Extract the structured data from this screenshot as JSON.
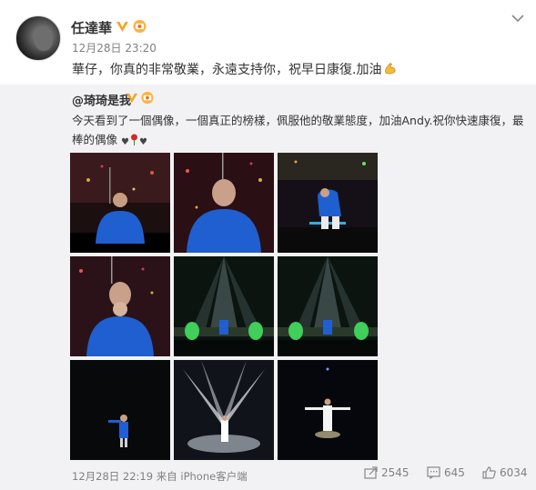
{
  "author": {
    "name": "任達華",
    "time": "12月28日 23:20",
    "verified_icon": "verified-v-icon",
    "vip_icon": "vip-badge-icon"
  },
  "post": {
    "text": "華仔，你真的非常敬業，永遠支持你，祝早日康復.加油",
    "emoji": "flexed-biceps-icon"
  },
  "repost": {
    "original_user": "@琦琦是我",
    "text": "今天看到了一個偶像，一個真正的榜樣，佩服他的敬業態度，加油Andy.祝你快速康復，最棒的偶像",
    "emoji_icons": [
      "heart-icon",
      "rose-icon",
      "heart-icon"
    ],
    "photos": [
      "photo-1",
      "photo-2",
      "photo-3",
      "photo-4",
      "photo-5",
      "photo-6",
      "photo-7",
      "photo-8",
      "photo-9"
    ],
    "footer": {
      "time": "12月28日 22:19",
      "source": "来自 iPhone客户端"
    },
    "actions": {
      "reposts": "2545",
      "comments": "645",
      "likes": "6034"
    }
  },
  "colors": {
    "text": "#333333",
    "meta": "#808080",
    "repost_bg": "#f2f2f5",
    "verified": "#f5a623",
    "jacket_blue": "#1f5fd0"
  }
}
